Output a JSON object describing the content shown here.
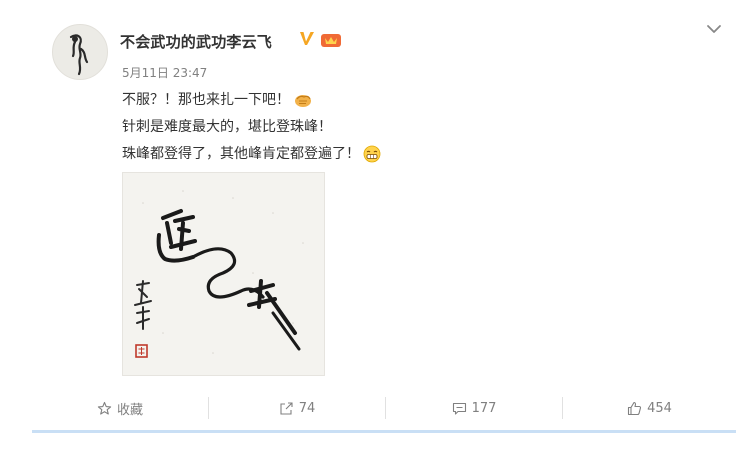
{
  "post": {
    "author": "不会武功的武功李云飞",
    "timestamp": "5月11日 23:47",
    "lines": [
      "不服？！那也来扎一下吧！",
      "针刺是难度最大的，堪比登珠峰！",
      "珠峰都登得了，其他峰肯定都登遍了！"
    ],
    "image_calligraphy": {
      "main_text": "遥 … 环",
      "signature": "易尊"
    }
  },
  "actions": {
    "favorite_label": "收藏",
    "repost_count": "74",
    "comment_count": "177",
    "like_count": "454"
  },
  "icons": {
    "verified": "verified-v-icon",
    "member": "member-crown-icon",
    "more": "chevron-down-icon",
    "fav": "star-icon",
    "repost": "share-arrow-icon",
    "comment": "comment-icon",
    "like": "thumbs-up-icon"
  },
  "colors": {
    "verified": "#f5a623",
    "member_badge": "#f06a35",
    "accent_bar": "#c9dff5"
  }
}
